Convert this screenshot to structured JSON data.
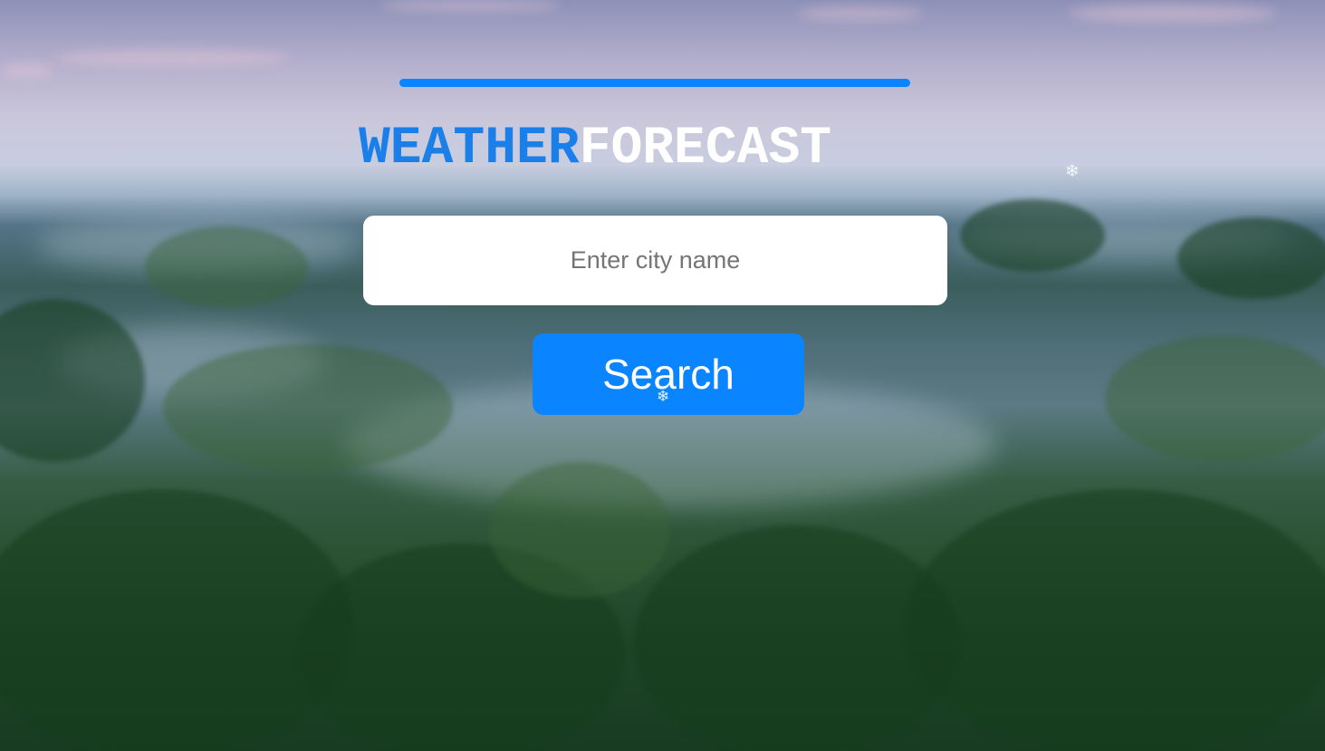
{
  "header": {
    "title_part_1": "WEATHER",
    "title_part_2": "FORECAST"
  },
  "search": {
    "placeholder": "Enter city name",
    "value": "",
    "button_label": "Search"
  },
  "decorations": {
    "snowflake_glyph": "❄",
    "snowflake_icon": "snowflake-icon"
  },
  "colors": {
    "accent": "#0a84ff",
    "title_weather": "#1a7fe8",
    "title_forecast": "#ffffff"
  }
}
